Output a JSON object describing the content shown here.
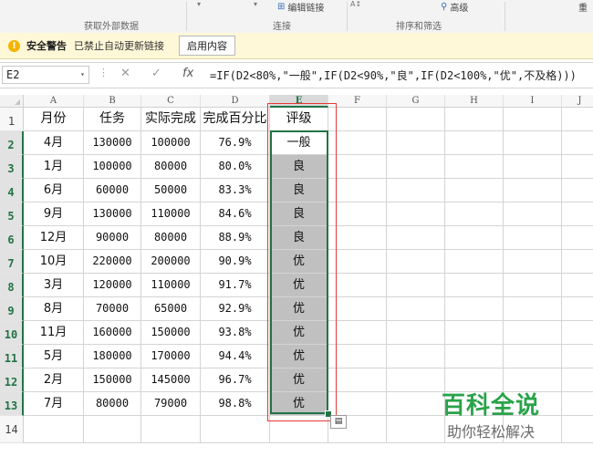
{
  "ribbon": {
    "group_external": "获取外部数据",
    "group_connections": "连接",
    "group_sortfilter": "排序和筛选",
    "edit_links": "编辑链接",
    "advanced": "高级",
    "reapply": "重"
  },
  "security_bar": {
    "title": "安全警告",
    "message": "已禁止自动更新链接",
    "enable_label": "启用内容"
  },
  "formula_bar": {
    "name_box": "E2",
    "formula": "=IF(D2<80%,\"一般\",IF(D2<90%,\"良\",IF(D2<100%,\"优\",不及格)))"
  },
  "sheet": {
    "columns": [
      "A",
      "B",
      "C",
      "D",
      "E",
      "F",
      "G",
      "H",
      "I",
      "J"
    ],
    "header_row": [
      "月份",
      "任务",
      "实际完成",
      "完成百分比",
      "评级"
    ],
    "rows": [
      [
        "4月",
        "130000",
        "100000",
        "76.9%",
        "一般"
      ],
      [
        "1月",
        "100000",
        "80000",
        "80.0%",
        "良"
      ],
      [
        "6月",
        "60000",
        "50000",
        "83.3%",
        "良"
      ],
      [
        "9月",
        "130000",
        "110000",
        "84.6%",
        "良"
      ],
      [
        "12月",
        "90000",
        "80000",
        "88.9%",
        "良"
      ],
      [
        "10月",
        "220000",
        "200000",
        "90.9%",
        "优"
      ],
      [
        "3月",
        "120000",
        "110000",
        "91.7%",
        "优"
      ],
      [
        "8月",
        "70000",
        "65000",
        "92.9%",
        "优"
      ],
      [
        "11月",
        "160000",
        "150000",
        "93.8%",
        "优"
      ],
      [
        "5月",
        "180000",
        "170000",
        "94.4%",
        "优"
      ],
      [
        "2月",
        "150000",
        "145000",
        "96.7%",
        "优"
      ],
      [
        "7月",
        "80000",
        "79000",
        "98.8%",
        "优"
      ]
    ],
    "row_numbers": [
      "1",
      "2",
      "3",
      "4",
      "5",
      "6",
      "7",
      "8",
      "9",
      "10",
      "11",
      "12",
      "13",
      "14"
    ],
    "active_cell": "E2"
  },
  "watermark": {
    "title": "百科全说",
    "subtitle": "助你轻松解决"
  },
  "colors": {
    "accent": "#217346",
    "annotation": "#e53935",
    "warning_bg": "#fff8d8",
    "watermark_green": "#2aa34a"
  }
}
